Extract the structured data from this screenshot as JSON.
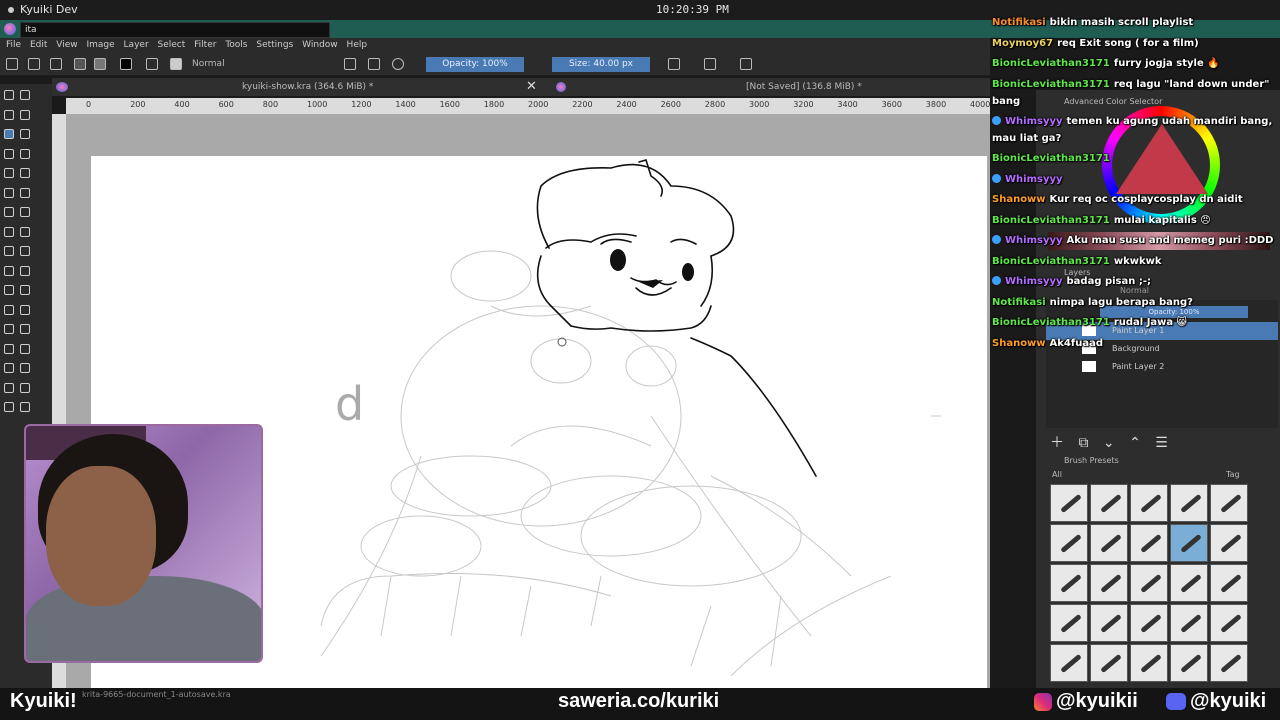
{
  "os": {
    "app_name": "Kyuiki Dev",
    "clock": "10:20:39 PM"
  },
  "titlebar": {
    "input_value": "ita"
  },
  "menu": {
    "items": [
      "File",
      "Edit",
      "View",
      "Image",
      "Layer",
      "Select",
      "Filter",
      "Tools",
      "Settings",
      "Window",
      "Help"
    ]
  },
  "toolbar": {
    "blend_mode": "Normal",
    "opacity": "Opacity: 100%",
    "size": "Size: 40.00 px"
  },
  "tabs": [
    {
      "label": "kyuiki-show.kra (364.6 MiB) *"
    },
    {
      "label": "[Not Saved]  (136.8 MiB) *"
    }
  ],
  "ruler": {
    "ticks": [
      "0",
      "200",
      "400",
      "600",
      "800",
      "1000",
      "1200",
      "1400",
      "1600",
      "1800",
      "2000",
      "2200",
      "2400",
      "2600",
      "2800",
      "3000",
      "3200",
      "3400",
      "3600",
      "3800",
      "4000"
    ]
  },
  "panels": {
    "color_selector": "Advanced Color Selector",
    "layers": {
      "title": "Layers",
      "blend": "Normal",
      "opacity": "Opacity: 100%",
      "items": [
        "Paint Layer 1",
        "Background",
        "Paint Layer 2"
      ]
    },
    "brush_presets": {
      "title": "Brush Presets",
      "filter": "All",
      "tag": "Tag"
    }
  },
  "chat": [
    {
      "name": "Notifikasi",
      "text": "bikin masih scroll playlist",
      "color": "#ff8c2a"
    },
    {
      "name": "Moymoy67",
      "text": "req Exit song ( for a film)",
      "color": "#e9d25f"
    },
    {
      "name": "BionicLeviathan3171",
      "text": "furry jogja style 🔥",
      "color": "#5ee84a"
    },
    {
      "name": "BionicLeviathan3171",
      "text": "req lagu \"land down under\"",
      "color": "#5ee84a"
    },
    {
      "name": "",
      "text": "bang",
      "color": "#ffffff"
    },
    {
      "name": "Whimsyyy",
      "text": "temen ku agung udah mandiri bang,",
      "color": "#b46cff"
    },
    {
      "name": "",
      "text": "mau liat ga?",
      "color": "#ffffff"
    },
    {
      "name": "BionicLeviathan3171",
      "text": "",
      "color": "#5ee84a"
    },
    {
      "name": "Whimsyyy",
      "text": "",
      "color": "#b46cff"
    },
    {
      "name": "Shanoww",
      "text": "Kur req oc cosplaycosplay dn aidit",
      "color": "#ff9d2a"
    },
    {
      "name": "BionicLeviathan3171",
      "text": "mulai kapitalis 😠",
      "color": "#5ee84a"
    },
    {
      "name": "Whimsyyy",
      "text": "Aku mau susu and memeg puri :DDD",
      "color": "#b46cff"
    },
    {
      "name": "BionicLeviathan3171",
      "text": "wkwkwk",
      "color": "#5ee84a"
    },
    {
      "name": "Whimsyyy",
      "text": "badag pisan ;-;",
      "color": "#b46cff"
    },
    {
      "name": "Notifikasi",
      "text": "nimpa lagu berapa bang?",
      "color": "#5ee84a"
    },
    {
      "name": "BionicLeviathan3171",
      "text": "rudal Jawa 😸",
      "color": "#5ee84a"
    },
    {
      "name": "Shanoww",
      "text": "Ak4fuaad",
      "color": "#ff9d2a"
    }
  ],
  "statusbar": {
    "file": "krita-9665-document_1-autosave.kra"
  },
  "overlay": {
    "name": "Kyuiki!",
    "link": "saweria.co/kuriki",
    "instagram": "@kyuikii",
    "discord": "@kyuiki"
  }
}
